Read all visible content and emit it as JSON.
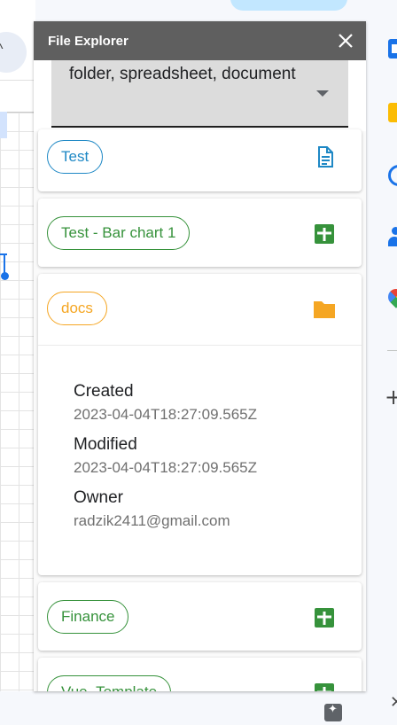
{
  "panel": {
    "title": "File Explorer",
    "close_icon": "close-icon"
  },
  "filter": {
    "selected_value": "folder, spreadsheet, document",
    "icon": "dropdown-arrow-icon"
  },
  "files": [
    {
      "name": "Test",
      "type": "document",
      "icon": "document-icon",
      "color": "#1e88c5"
    },
    {
      "name": "Test - Bar chart 1",
      "type": "spreadsheet",
      "icon": "spreadsheet-icon",
      "color": "#36923b"
    },
    {
      "name": "docs",
      "type": "folder",
      "icon": "folder-icon",
      "color": "#f5a623",
      "expanded": true,
      "details": {
        "created_label": "Created",
        "created": "2023-04-04T18:27:09.565Z",
        "modified_label": "Modified",
        "modified": "2023-04-04T18:27:09.565Z",
        "owner_label": "Owner",
        "owner": "radzik2411@gmail.com"
      }
    },
    {
      "name": "Finance",
      "type": "spreadsheet",
      "icon": "spreadsheet-icon",
      "color": "#36923b"
    },
    {
      "name": "Vue_Template",
      "type": "spreadsheet",
      "icon": "spreadsheet-icon",
      "color": "#36923b"
    }
  ],
  "side_rail": {
    "icons": [
      "calendar-icon",
      "keep-icon",
      "tasks-icon",
      "contacts-icon",
      "maps-icon",
      "add-icon",
      "close-icon"
    ]
  },
  "bottom": {
    "icon": "explore-icon"
  }
}
